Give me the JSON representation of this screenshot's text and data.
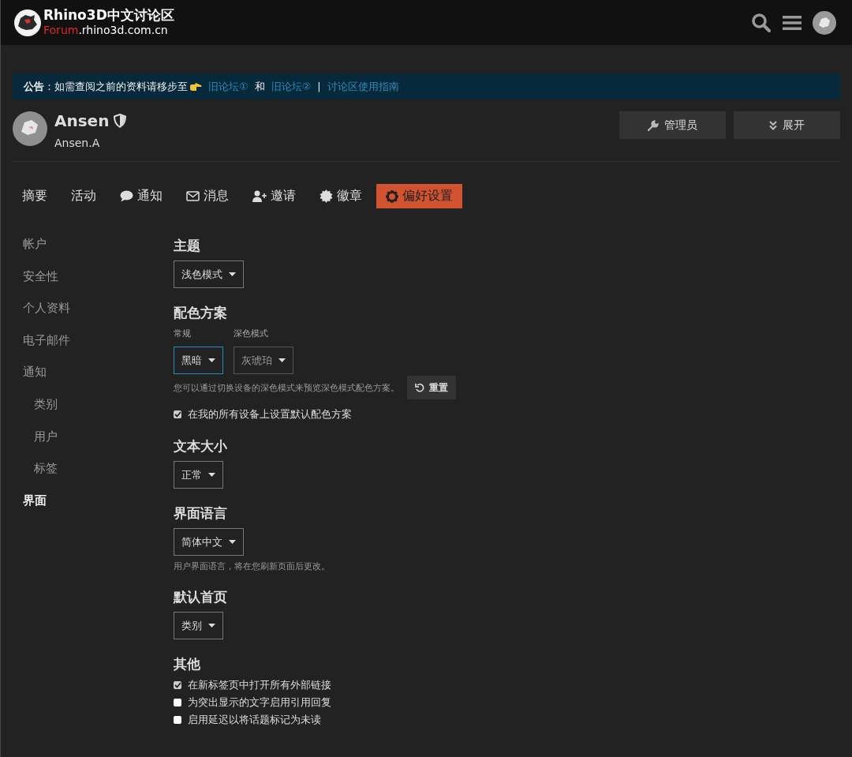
{
  "header": {
    "site_title": "Rhino3D中文讨论区",
    "domain": {
      "highlight": "Forum",
      "rest": ".rhino3d.com.cn"
    }
  },
  "banner": {
    "text": "**公告**：如需查阅之前的资料请移步至",
    "links": [
      {
        "kind": "link",
        "text": "旧论坛①"
      },
      {
        "kind": "plain",
        "text": "和"
      },
      {
        "kind": "link",
        "text": "旧论坛②"
      },
      {
        "kind": "plain",
        "text": "|"
      },
      {
        "kind": "link",
        "text": "讨论区使用指南"
      }
    ]
  },
  "profile": {
    "name": "Ansen",
    "username": "Ansen.A",
    "buttons": [
      {
        "kind": "admin",
        "label": "管理员"
      },
      {
        "kind": "expand",
        "label": "展开"
      }
    ]
  },
  "tabs": [
    {
      "label": "摘要",
      "kind": "summary",
      "selected": false
    },
    {
      "label": "活动",
      "kind": "activity",
      "selected": false
    },
    {
      "label": "通知",
      "kind": "notifications",
      "selected": false
    },
    {
      "label": "消息",
      "kind": "messages",
      "selected": false
    },
    {
      "label": "邀请",
      "kind": "invites",
      "selected": false
    },
    {
      "label": "徽章",
      "kind": "badges",
      "selected": false
    },
    {
      "label": "偏好设置",
      "kind": "preferences",
      "selected": true
    }
  ],
  "sidebar": {
    "items": [
      {
        "label": "帐户",
        "selected": false
      },
      {
        "label": "安全性",
        "selected": false
      },
      {
        "label": "个人资料",
        "selected": false
      },
      {
        "label": "电子邮件",
        "selected": false
      },
      {
        "label": "通知",
        "selected": false,
        "children": [
          {
            "label": "类别",
            "selected": false
          },
          {
            "label": "用户",
            "selected": false
          },
          {
            "label": "标签",
            "selected": false
          }
        ]
      },
      {
        "label": "界面",
        "selected": true
      }
    ]
  },
  "sections": [
    {
      "kind": "dropdown",
      "title": "主题",
      "value": "浅色模式"
    },
    {
      "kind": "color_scheme",
      "title": "配色方案",
      "columns": [
        {
          "label": "常规",
          "value": "黑暗",
          "focused": true
        },
        {
          "label": "深色模式",
          "value": "灰琥珀",
          "focused": false
        }
      ],
      "hint": "您可以通过切换设备的深色模式来预览深色模式配色方案。",
      "reset_button": "重置",
      "checkbox": {
        "label": "在我的所有设备上设置默认配色方案",
        "checked": true
      }
    },
    {
      "kind": "dropdown",
      "title": "文本大小",
      "value": "正常"
    },
    {
      "kind": "dropdown",
      "title": "界面语言",
      "value": "简体中文",
      "hint": "用户界面语言，将在您刷新页面后更改。"
    },
    {
      "kind": "dropdown",
      "title": "默认首页",
      "value": "类别"
    },
    {
      "kind": "checkboxes",
      "title": "其他",
      "options": [
        {
          "label": "在新标签页中打开所有外部链接",
          "checked": true
        },
        {
          "label": "为突出显示的文字启用引用回复",
          "checked": false
        },
        {
          "label": "启用延迟以将话题标记为未读",
          "checked": false
        }
      ]
    }
  ]
}
